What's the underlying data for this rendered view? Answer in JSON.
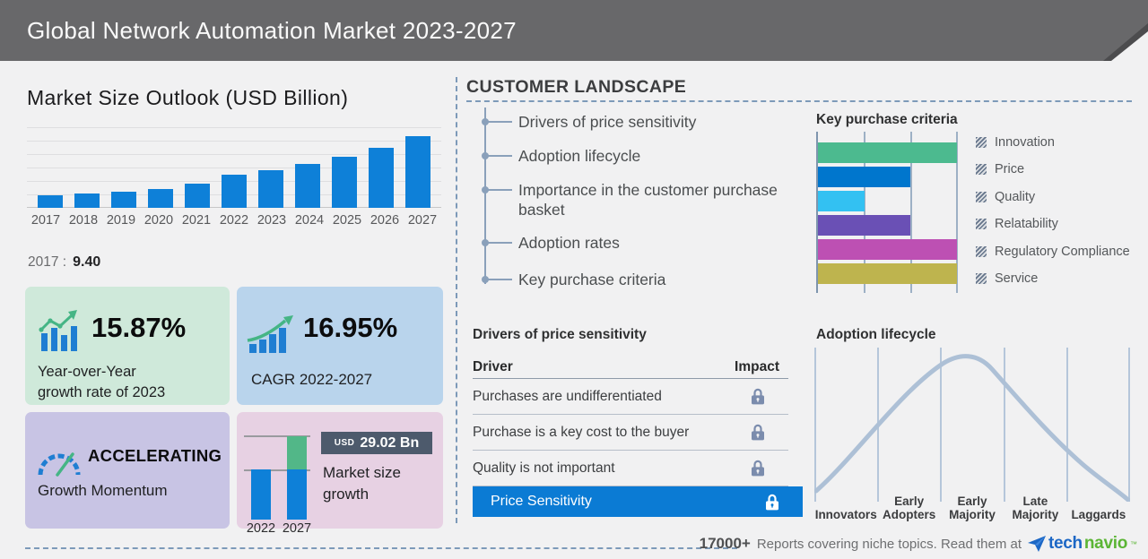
{
  "header": {
    "title": "Global Network Automation Market 2023-2027"
  },
  "market_size": {
    "base_year_label": "2017 :",
    "base_year_value": "9.40"
  },
  "stats": {
    "yoy": {
      "value": "15.87%",
      "line1": "Year-over-Year",
      "line2": "growth rate of 2023"
    },
    "cagr": {
      "value": "16.95%",
      "label": "CAGR 2022-2027"
    },
    "momentum": {
      "value": "ACCELERATING",
      "label": "Growth Momentum"
    },
    "growth": {
      "currency": "USD",
      "amount": "29.02 Bn",
      "line1": "Market size",
      "line2": "growth"
    }
  },
  "customer_landscape": {
    "heading": "CUSTOMER LANDSCAPE",
    "items": [
      "Drivers of price sensitivity",
      "Adoption lifecycle",
      "Importance in the customer purchase basket",
      "Adoption rates",
      "Key purchase criteria"
    ]
  },
  "price_sensitivity": {
    "heading": "Drivers of price sensitivity",
    "col_driver": "Driver",
    "col_impact": "Impact",
    "rows": [
      "Purchases are undifferentiated",
      "Purchase is a key cost to the buyer",
      "Quality is not important"
    ],
    "highlight": "Price Sensitivity",
    "highlight_color": "#0b7bd4",
    "lock_color": "#7b8cad"
  },
  "footer": {
    "count": "17000+",
    "text": "Reports covering niche topics. Read them at",
    "brand_tech": "tech",
    "brand_navio": "navio",
    "tm": "™"
  },
  "chart_data": [
    {
      "id": "market_size_outlook",
      "type": "bar",
      "title": "Market Size Outlook (USD Billion)",
      "categories": [
        "2017",
        "2018",
        "2019",
        "2020",
        "2021",
        "2022",
        "2023",
        "2024",
        "2025",
        "2026",
        "2027"
      ],
      "values": [
        9.4,
        10.6,
        12.1,
        14.2,
        18.0,
        24.4,
        28.3,
        32.8,
        38.2,
        44.8,
        53.5
      ],
      "labeled_point": {
        "x": "2017",
        "y": 9.4
      },
      "xlabel": "",
      "ylabel": "USD Billion",
      "ylim": [
        0,
        60
      ],
      "grid": true,
      "bar_color": "#0e80d8"
    },
    {
      "id": "key_purchase_criteria",
      "type": "bar",
      "orientation": "horizontal",
      "title": "Key purchase criteria",
      "categories": [
        "Innovation",
        "Price",
        "Quality",
        "Relatability",
        "Regulatory Compliance",
        "Service"
      ],
      "values": [
        3,
        2,
        1,
        2,
        3,
        3
      ],
      "xlim": [
        0,
        3
      ],
      "colors": [
        "#4cba8f",
        "#0076cd",
        "#33c1f2",
        "#6a50b5",
        "#bd50b3",
        "#beb44e"
      ],
      "legend_position": "right",
      "grid": true
    },
    {
      "id": "market_size_growth",
      "type": "bar",
      "title": "Market size growth",
      "categories": [
        "2022",
        "2027"
      ],
      "values": [
        24.43,
        53.45
      ],
      "growth_usd_bn": 29.02,
      "colors": {
        "base": "#0e80d8",
        "growth": "#52b788"
      }
    },
    {
      "id": "adoption_lifecycle",
      "type": "area",
      "title": "Adoption lifecycle",
      "categories": [
        "Innovators",
        "Early Adopters",
        "Early Majority",
        "Late Majority",
        "Laggards"
      ],
      "label_lines": [
        [
          "Innovators"
        ],
        [
          "Early",
          "Adopters"
        ],
        [
          "Early",
          "Majority"
        ],
        [
          "Late",
          "Majority"
        ],
        [
          "Laggards"
        ]
      ],
      "shape": "bell curve peaking over Early Majority",
      "curve_color": "#adc0d6"
    }
  ]
}
